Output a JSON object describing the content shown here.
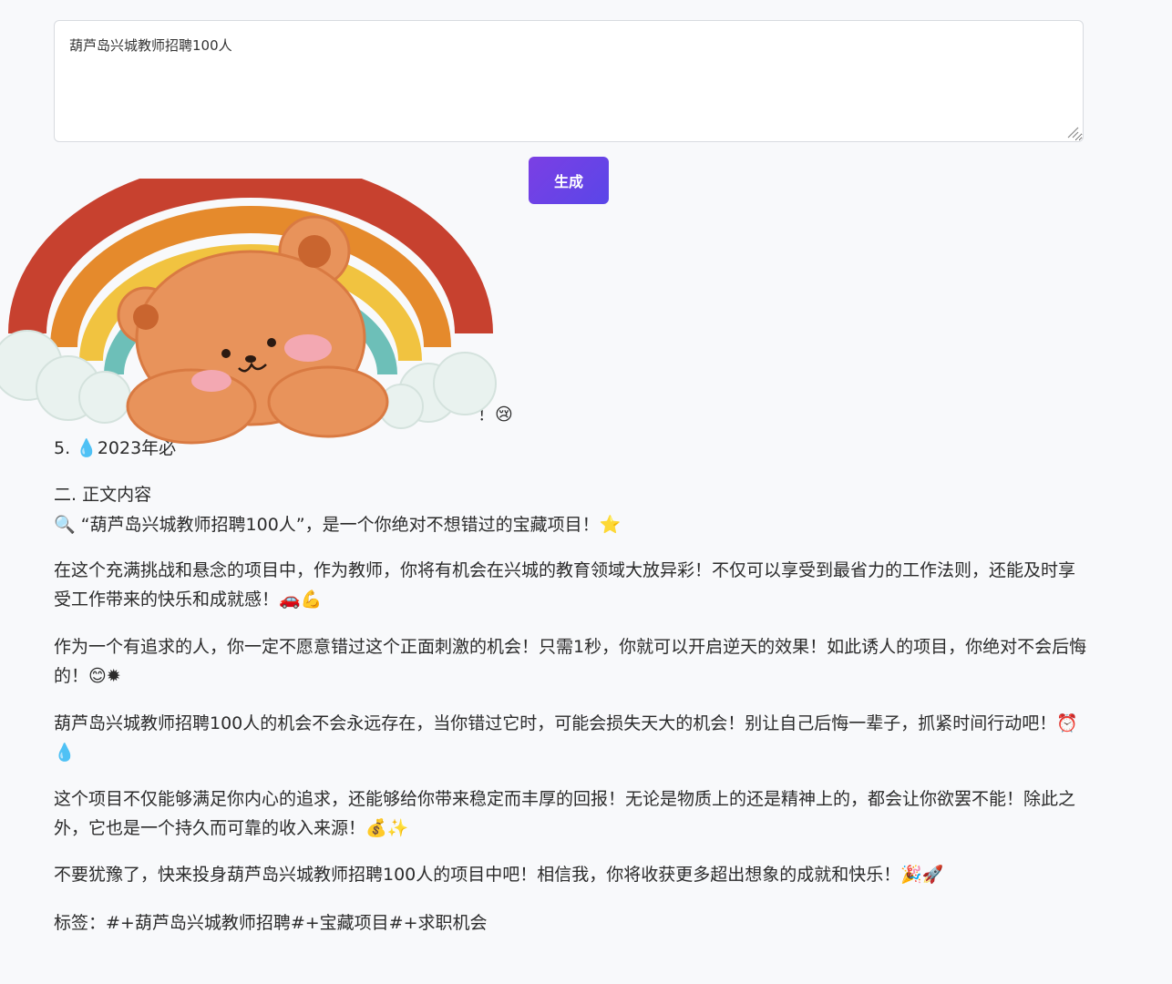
{
  "prompt": {
    "value": "葫芦岛兴城教师招聘100人"
  },
  "generate_button": {
    "label": "生成"
  },
  "titles": {
    "partial_line_4": "！😢",
    "line_5": "5. 💧2023年必"
  },
  "body": {
    "section_heading": "二. 正文内容",
    "intro": "🔍 “葫芦岛兴城教师招聘100人”，是一个你绝对不想错过的宝藏项目！⭐",
    "paragraphs": [
      "在这个充满挑战和悬念的项目中，作为教师，你将有机会在兴城的教育领域大放异彩！不仅可以享受到最省力的工作法则，还能及时享受工作带来的快乐和成就感！🚗💪",
      "作为一个有追求的人，你一定不愿意错过这个正面刺激的机会！只需1秒，你就可以开启逆天的效果！如此诱人的项目，你绝对不会后悔的！😊✹",
      "葫芦岛兴城教师招聘100人的机会不会永远存在，当你错过它时，可能会损失天大的机会！别让自己后悔一辈子，抓紧时间行动吧！⏰💧",
      "这个项目不仅能够满足你内心的追求，还能够给你带来稳定而丰厚的回报！无论是物质上的还是精神上的，都会让你欲罢不能！除此之外，它也是一个持久而可靠的收入来源！💰✨",
      "不要犹豫了，快来投身葫芦岛兴城教师招聘100人的项目中吧！相信我，你将收获更多超出想象的成就和快乐！🎉🚀",
      "标签：#+葫芦岛兴城教师招聘#+宝藏项目#+求职机会"
    ]
  },
  "colors": {
    "button_start": "#7b3fe4",
    "button_end": "#5a46e8",
    "rainbow": [
      "#c7412f",
      "#e58a2c",
      "#f1c340",
      "#6dbfb8"
    ],
    "bear": "#e8935b"
  }
}
